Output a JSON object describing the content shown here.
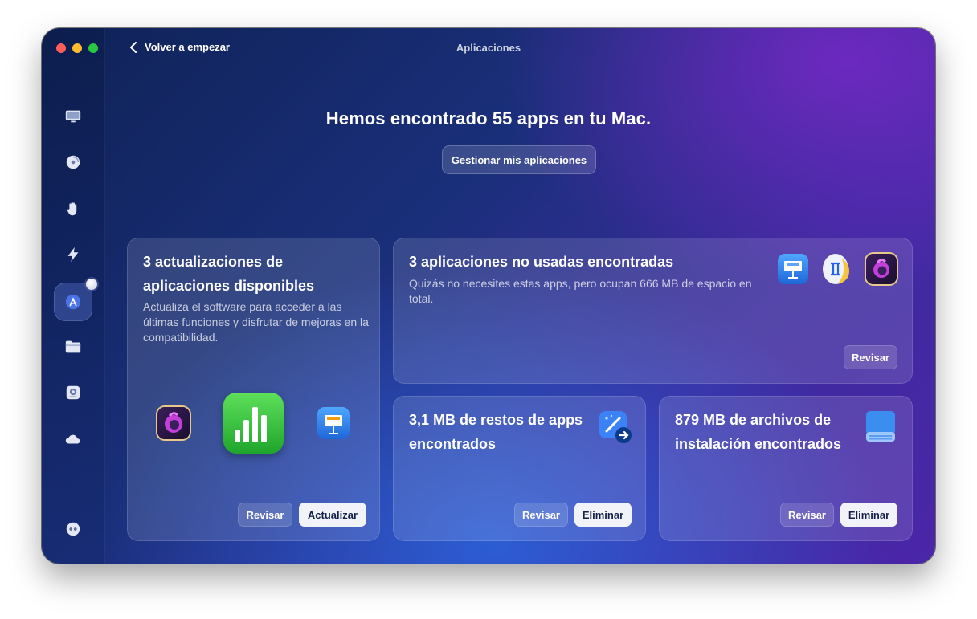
{
  "window": {
    "title": "Aplicaciones",
    "back_label": "Volver a empezar"
  },
  "sidebar": {
    "items": [
      {
        "name": "sidebar-item-smart-care",
        "icon": "monitor-icon"
      },
      {
        "name": "sidebar-item-cleanup",
        "icon": "disc-icon"
      },
      {
        "name": "sidebar-item-protection",
        "icon": "hand-icon"
      },
      {
        "name": "sidebar-item-performance",
        "icon": "lightning-icon"
      },
      {
        "name": "sidebar-item-applications",
        "icon": "app-store-icon",
        "active": true
      },
      {
        "name": "sidebar-item-my-clutter",
        "icon": "folder-icon"
      },
      {
        "name": "sidebar-item-space-lens",
        "icon": "drive-icon"
      },
      {
        "name": "sidebar-item-cloud",
        "icon": "cloud-icon"
      },
      {
        "name": "sidebar-item-assistant",
        "icon": "assistant-icon"
      }
    ]
  },
  "main": {
    "headline": "Hemos encontrado 55 apps en tu Mac.",
    "manage_button": "Gestionar mis aplicaciones",
    "cards": {
      "updates": {
        "title_line1": "3 actualizaciones de",
        "title_line2": "aplicaciones disponibles",
        "description": "Actualiza el software para acceder a las últimas funciones y disfrutar de mejoras en la compatibilidad.",
        "review_label": "Revisar",
        "action_label": "Actualizar"
      },
      "unused": {
        "title": "3 aplicaciones no usadas encontradas",
        "description": "Quizás no necesites estas apps, pero ocupan 666 MB de espacio en total.",
        "review_label": "Revisar"
      },
      "leftovers": {
        "title_line1": "3,1 MB de restos de apps",
        "title_line2": "encontrados",
        "review_label": "Revisar",
        "action_label": "Eliminar"
      },
      "installers": {
        "title_line1": "879 MB de archivos de",
        "title_line2": "instalación encontrados",
        "review_label": "Revisar",
        "action_label": "Eliminar"
      }
    }
  },
  "colors": {
    "accent": "#f2f3f8",
    "window_dark": "#0f2257",
    "window_purple": "#4b26a8"
  }
}
